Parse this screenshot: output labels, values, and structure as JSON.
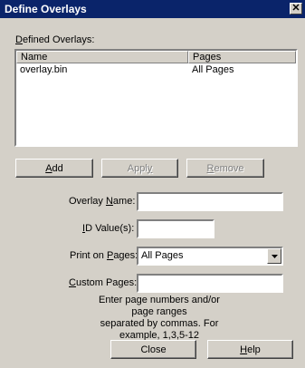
{
  "window": {
    "title": "Define Overlays",
    "close_glyph": "✕",
    "close_icon": "close-icon"
  },
  "defined_overlays_label": "Defined Overlays:",
  "list": {
    "columns": [
      "Name",
      "Pages"
    ],
    "rows": [
      {
        "name": "overlay.bin",
        "pages": "All Pages"
      }
    ]
  },
  "buttons": {
    "add": "Add",
    "apply": "Apply",
    "remove": "Remove",
    "close": "Close",
    "help": "Help"
  },
  "fields": {
    "overlay_name_label": "Overlay Name:",
    "overlay_name_value": "",
    "id_values_label": "ID Value(s):",
    "id_values_value": "",
    "print_on_pages_label": "Print on Pages:",
    "print_on_pages_value": "All Pages",
    "custom_pages_label": "Custom Pages:",
    "custom_pages_value": ""
  },
  "hint": {
    "line1": "Enter page numbers and/or page ranges",
    "line2": "separated by commas. For example, 1,3,5-12"
  },
  "icons": {
    "dropdown": "chevron-down-icon"
  }
}
